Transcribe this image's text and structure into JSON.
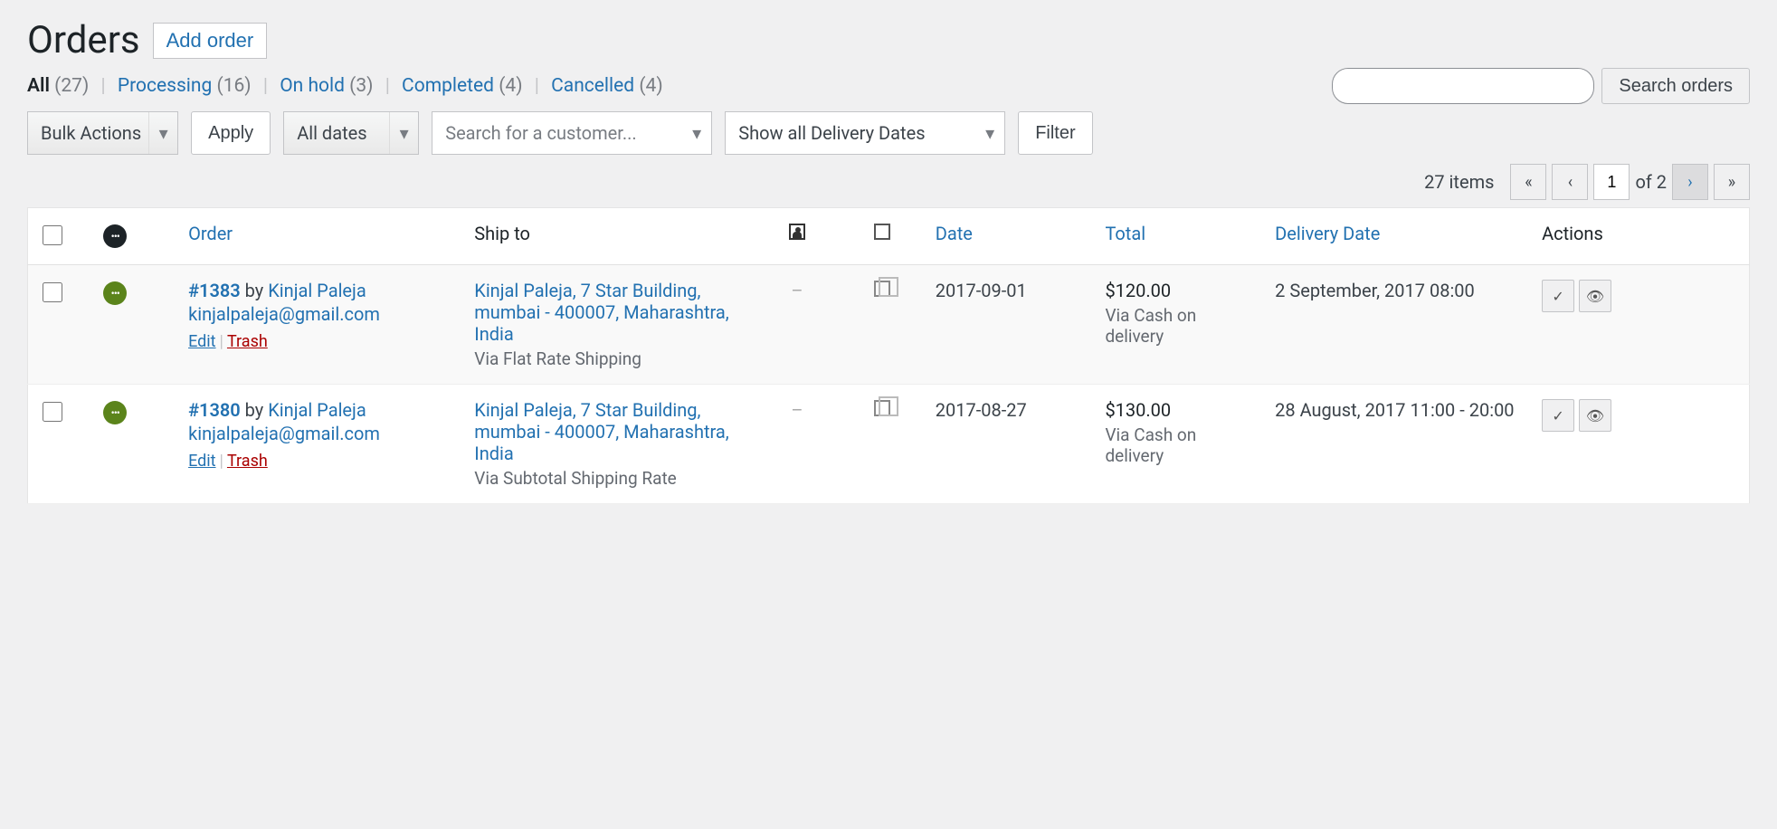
{
  "page": {
    "title": "Orders",
    "add_button": "Add order"
  },
  "status_filters": {
    "all": {
      "label": "All",
      "count": "(27)"
    },
    "processing": {
      "label": "Processing",
      "count": "(16)"
    },
    "onhold": {
      "label": "On hold",
      "count": "(3)"
    },
    "completed": {
      "label": "Completed",
      "count": "(4)"
    },
    "cancelled": {
      "label": "Cancelled",
      "count": "(4)"
    }
  },
  "search": {
    "button": "Search orders"
  },
  "toolbar": {
    "bulk_actions": "Bulk Actions",
    "apply": "Apply",
    "all_dates": "All dates",
    "customer_placeholder": "Search for a customer...",
    "delivery_dates": "Show all Delivery Dates",
    "filter": "Filter"
  },
  "pagination": {
    "items": "27 items",
    "current": "1",
    "of_label": "of 2"
  },
  "columns": {
    "order": "Order",
    "ship_to": "Ship to",
    "date": "Date",
    "total": "Total",
    "delivery_date": "Delivery Date",
    "actions": "Actions"
  },
  "row_labels": {
    "edit": "Edit",
    "trash": "Trash",
    "by": " by "
  },
  "rows": [
    {
      "id": "#1383",
      "customer": "Kinjal Paleja",
      "email": "kinjalpaleja@gmail.com",
      "ship_addr": "Kinjal Paleja, 7 Star Building, mumbai - 400007, Maharashtra, India",
      "ship_via": "Via Flat Rate Shipping",
      "note": "–",
      "date": "2017-09-01",
      "total": "$120.00",
      "total_via": "Via Cash on delivery",
      "delivery": "2 September, 2017 08:00"
    },
    {
      "id": "#1380",
      "customer": "Kinjal Paleja",
      "email": "kinjalpaleja@gmail.com",
      "ship_addr": "Kinjal Paleja, 7 Star Building, mumbai - 400007, Maharashtra, India",
      "ship_via": "Via Subtotal Shipping Rate",
      "note": "–",
      "date": "2017-08-27",
      "total": "$130.00",
      "total_via": "Via Cash on delivery",
      "delivery": "28 August, 2017 11:00 - 20:00"
    }
  ]
}
